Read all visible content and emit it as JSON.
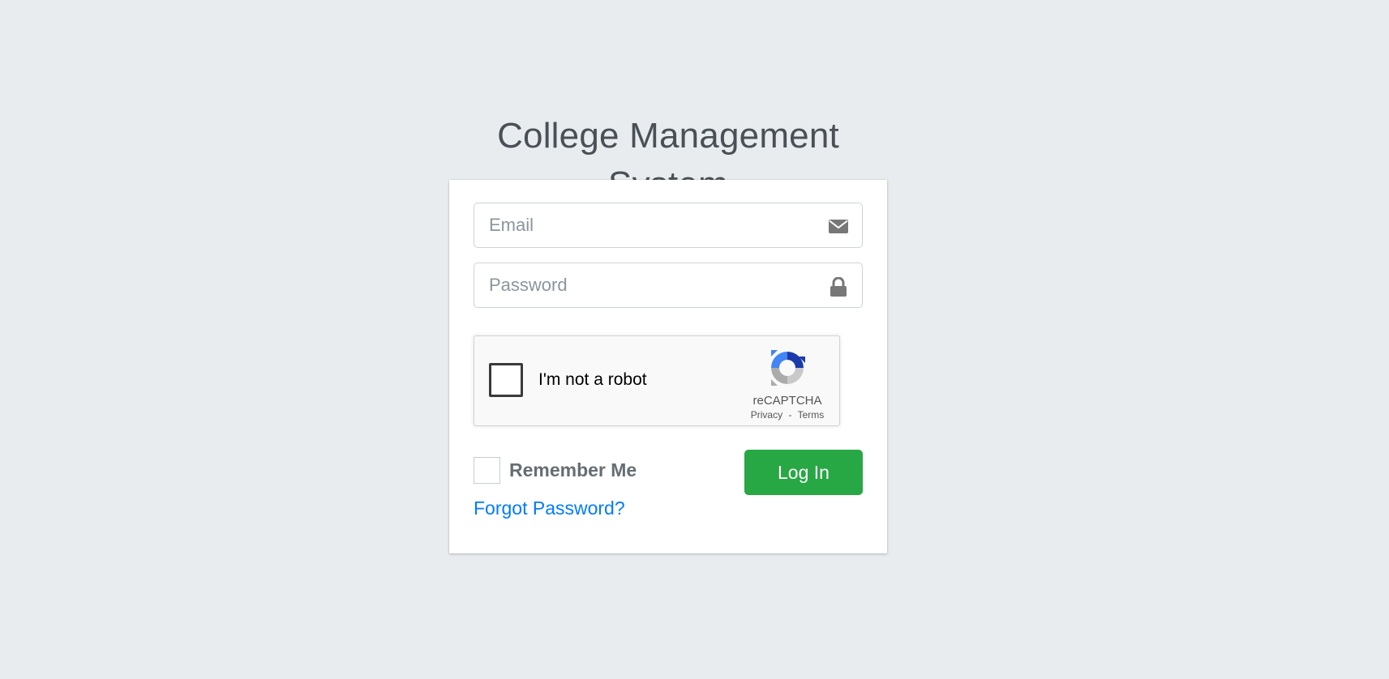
{
  "logo": {
    "bold": "College",
    "rest": "Management System"
  },
  "form": {
    "email_placeholder": "Email",
    "password_placeholder": "Password",
    "remember_label": "Remember Me",
    "login_label": "Log In",
    "forgot_label": "Forgot Password?"
  },
  "recaptcha": {
    "label": "I'm not a robot",
    "brand": "reCAPTCHA",
    "privacy": "Privacy",
    "separator": "-",
    "terms": "Terms"
  },
  "icons": {
    "email": "envelope-icon",
    "password": "lock-icon",
    "recaptcha": "recaptcha-logo-icon"
  },
  "colors": {
    "background": "#e9ecef",
    "card": "#ffffff",
    "login_button": "#28a745",
    "link": "#007bff",
    "icon": "#777777"
  }
}
